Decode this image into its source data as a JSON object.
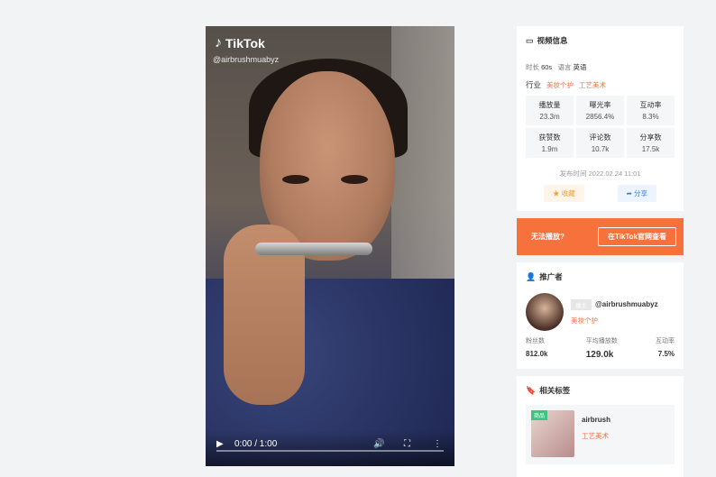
{
  "video": {
    "brand": "TikTok",
    "handle": "@airbrushmuabyz",
    "time": "0:00 / 1:00",
    "progress": 0
  },
  "info": {
    "title": "视频信息",
    "duration_label": "时长",
    "duration": "60s",
    "lang_label": "语言",
    "lang": "英语",
    "industry_label": "行业",
    "industry_tags": [
      "美妆个护",
      "工艺美术"
    ],
    "stats": [
      {
        "label": "播放量",
        "value": "23.3m"
      },
      {
        "label": "曝光率",
        "value": "2856.4%"
      },
      {
        "label": "互动率",
        "value": "8.3%"
      },
      {
        "label": "获赞数",
        "value": "1.9m"
      },
      {
        "label": "评论数",
        "value": "10.7k"
      },
      {
        "label": "分享数",
        "value": "17.5k"
      }
    ],
    "publish": "发布时间 2022.02.24 11:01",
    "fav_label": "收藏",
    "share_label": "分享"
  },
  "banner": {
    "text": "无法播放?",
    "button": "在TikTok官网查看"
  },
  "promoter": {
    "title": "推广者",
    "badge": "播主",
    "name": "@airbrushmuabyz",
    "tag": "美妆个护",
    "stats": [
      {
        "label": "粉丝数",
        "value": "812.0k"
      },
      {
        "label": "平均播放数",
        "value": "129.0k"
      },
      {
        "label": "互动率",
        "value": "7.5%"
      }
    ]
  },
  "tags": {
    "title": "相关标签",
    "badge": "商品",
    "name": "airbrush",
    "category": "工艺美术"
  }
}
